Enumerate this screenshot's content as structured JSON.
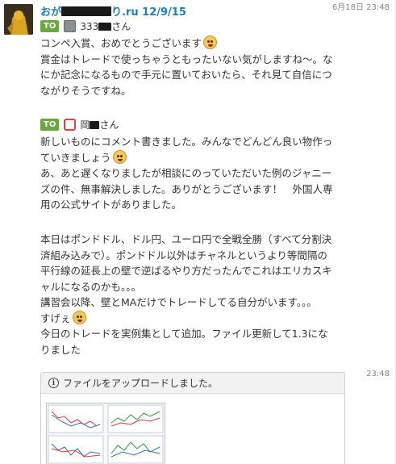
{
  "message": {
    "sender_prefix": "おが",
    "sender_suffix": "り.ru 12/9/15",
    "timestamp": "6月18日 23:48",
    "to_badge": "TO",
    "recipient1_suffix": "さん",
    "recipient1_prefix": "333",
    "paragraph1": [
      "コンペ入賞、おめでとうございます",
      "賞金はトレードで使っちゃうともったいない気がしますね～。な",
      "にか記念になるもので手元に置いておいたら、それ見て自信につ",
      "ながりそうですね。"
    ],
    "recipient2_prefix": "岡",
    "recipient2_suffix": "さん",
    "paragraph2": [
      "新しいものにコメント書きました。みんなでどんどん良い物作っ",
      "ていきましょう",
      "あ、あと遅くなりましたが相談にのっていただいた例のジャニー",
      "ズの件、無事解決しました。ありがとうございます！　外国人専",
      "用の公式サイトがありました。"
    ],
    "paragraph3": [
      "本日はポンドドル、ドル円、ユーロ円で全戦全勝（すべて分割決",
      "済組み込みで）。ポンドドル以外はチャネルというより等間隔の",
      "平行線の延長上の壁で逆ばるやり方だったんでこれはエリカスキ",
      "ャルになるのかも。。。",
      "講習会以降、壁とMAだけでトレードしてる自分がいます。。。",
      "すげぇ",
      "今日のトレードを実例集として追加。ファイル更新して1.3にな",
      "りました"
    ]
  },
  "file_message": {
    "timestamp": "23:48",
    "notice": "ファイルをアップロードしました。"
  },
  "icons": [
    "avatar",
    "info-icon",
    "emoji-icon",
    "chart-thumbnail"
  ]
}
